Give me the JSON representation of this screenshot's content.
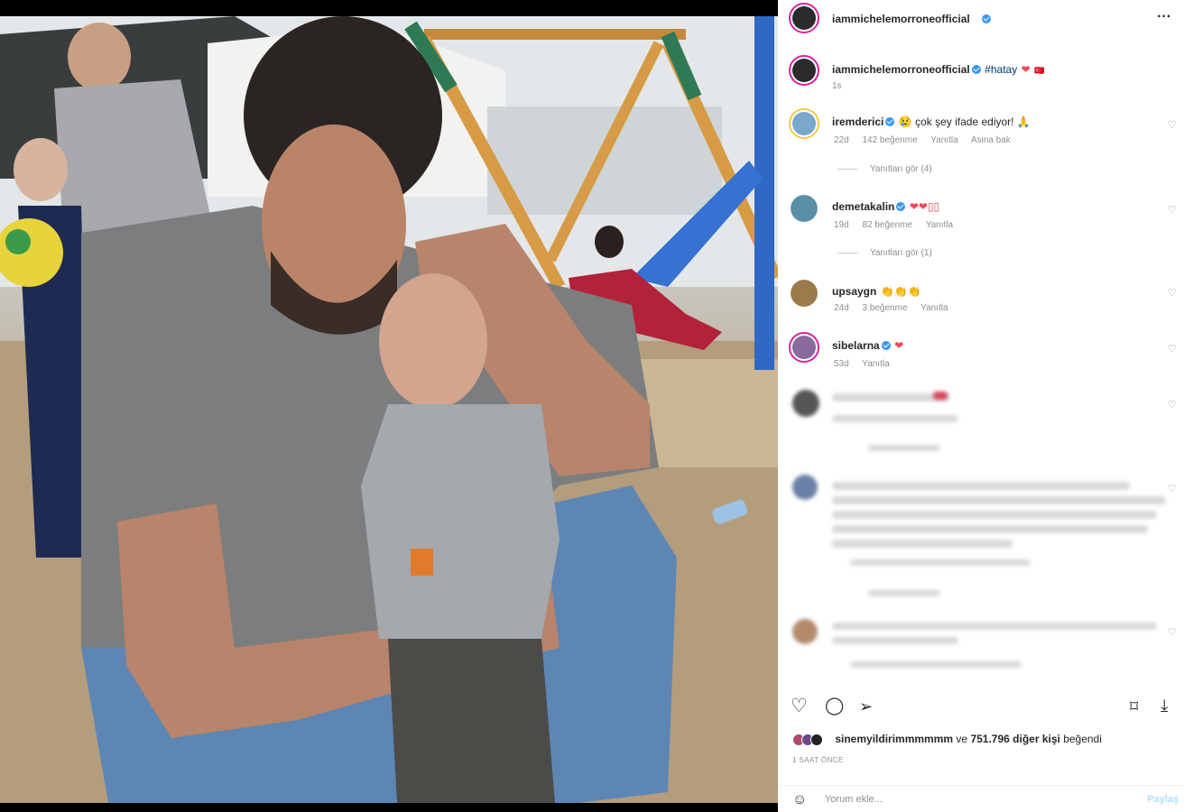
{
  "post": {
    "author": "iammichelemorroneofficial",
    "more_icon": "more-horizontal-icon"
  },
  "caption": {
    "author": "iammichelemorroneofficial",
    "hashtag": "#hatay",
    "emoji": "❤",
    "suffix": "🇹🇷",
    "time": "1s"
  },
  "comments": [
    {
      "user": "iremderici",
      "text": "😢 çok şey ifade ediyor! 🙏",
      "time": "22d",
      "likes": "142 beğenme",
      "reply": "Yanıtla",
      "translate": "Asina bak",
      "view_replies": "Yanıtları gör (4)",
      "avatar_color": "#7aa7cc"
    },
    {
      "user": "demetakalin",
      "text": "❤❤▯▯",
      "time": "19d",
      "likes": "82 beğenme",
      "reply": "Yanıtla",
      "view_replies": "Yanıtları gör (1)",
      "avatar_color": "#5a8fa8"
    },
    {
      "user": "upsaygn",
      "text": "👏👏👏",
      "time": "24d",
      "likes": "3 beğenme",
      "reply": "Yanıtla",
      "avatar_color": "#9b7b4b"
    },
    {
      "user": "sibelarna",
      "text": "❤",
      "time": "53d",
      "reply": "Yanıtla",
      "avatar_color": "#8a6a9c"
    }
  ],
  "actions": {
    "like_icon": "heart-icon",
    "comment_icon": "comment-icon",
    "share_icon": "send-icon",
    "save_icon": "bookmark-icon",
    "download_icon": "download-icon"
  },
  "likes": {
    "user": "sinemyildirimmmmmm",
    "connector": "ve",
    "others": "751.796 diğer kişi",
    "suffix": "beğendi"
  },
  "timestamp": "1 SAAT ÖNCE",
  "comment_box": {
    "placeholder": "Yorum ekle...",
    "post_label": "Paylaş"
  },
  "colors": {
    "accent": "#3897f0",
    "heart": "#ed4956",
    "link": "#00376b"
  }
}
